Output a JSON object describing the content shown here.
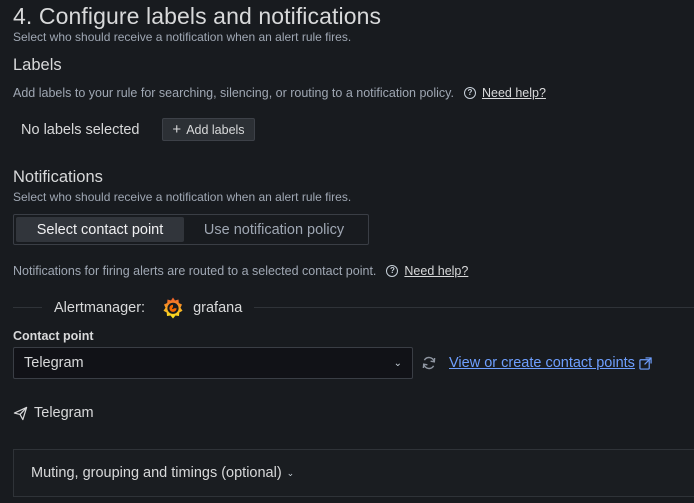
{
  "section": {
    "title": "4. Configure labels and notifications",
    "subtitle": "Select who should receive a notification when an alert rule fires."
  },
  "labels": {
    "heading": "Labels",
    "description": "Add labels to your rule for searching, silencing, or routing to a notification policy.",
    "help_link": "Need help?",
    "empty_text": "No labels selected",
    "add_button": "Add labels"
  },
  "notifications": {
    "heading": "Notifications",
    "description": "Select who should receive a notification when an alert rule fires.",
    "options": [
      "Select contact point",
      "Use notification policy"
    ],
    "selected_option": "Select contact point",
    "routing_info": "Notifications for firing alerts are routed to a selected contact point.",
    "help_link": "Need help?"
  },
  "alertmanager": {
    "label": "Alertmanager:",
    "name": "grafana"
  },
  "contact_point": {
    "label": "Contact point",
    "value": "Telegram",
    "view_link": "View or create contact points",
    "integration_name": "Telegram"
  },
  "advanced": {
    "label": "Muting, grouping and timings (optional)"
  },
  "colors": {
    "background": "#181b1f",
    "link": "#6e9fff",
    "grafana_orange": "#f46800"
  },
  "icons": {
    "help": "question-circle-icon",
    "add": "plus-icon",
    "logo": "grafana-logo-icon",
    "refresh": "sync-icon",
    "external": "external-link-icon",
    "integration": "telegram-send-icon",
    "chevron": "chevron-down-icon"
  }
}
